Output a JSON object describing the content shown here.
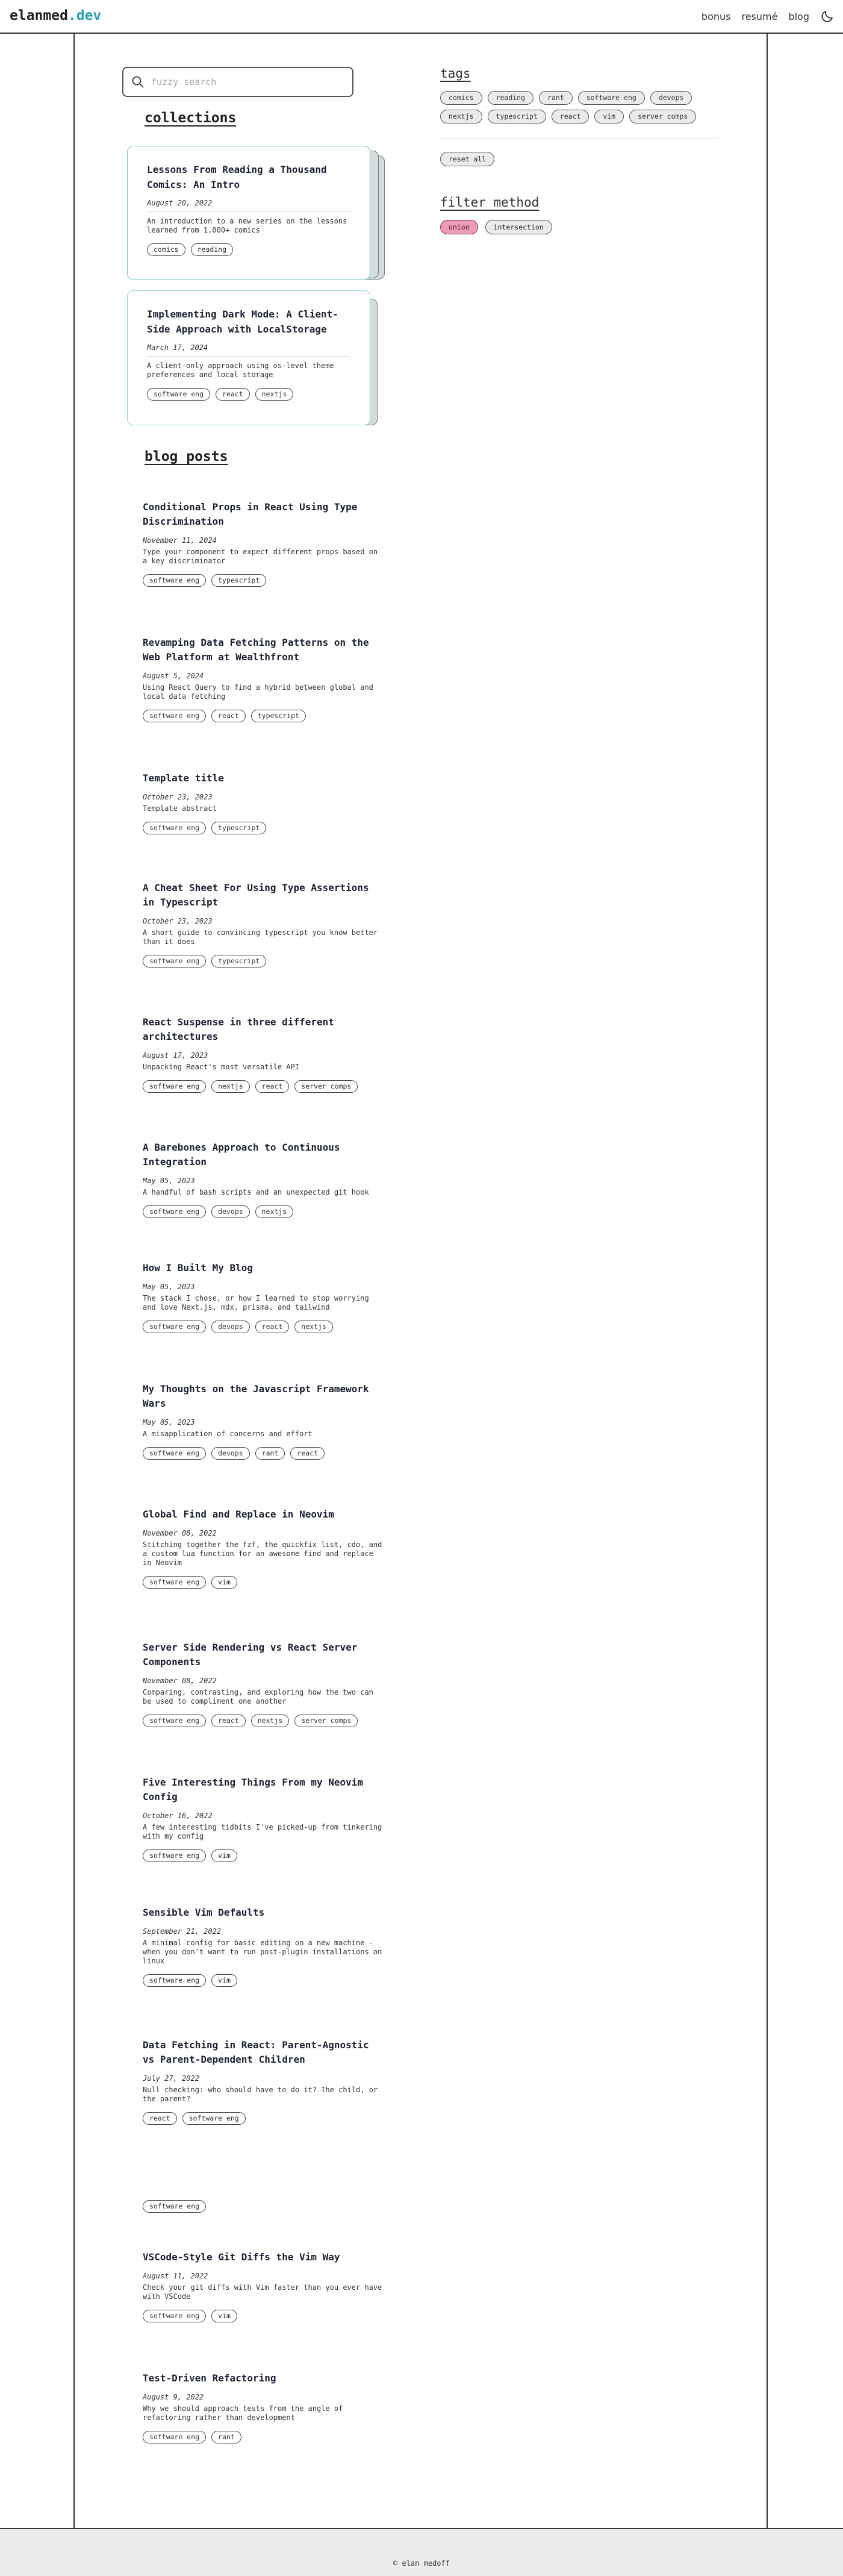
{
  "header": {
    "brand_main": "elanmed",
    "brand_ext": ".dev",
    "nav": [
      "bonus",
      "resumé",
      "blog"
    ]
  },
  "search": {
    "placeholder": "fuzzy search"
  },
  "collections_title": "collections",
  "collections": [
    {
      "title": "Lessons From Reading a Thousand Comics: An Intro",
      "date": "August 20, 2022",
      "description": "An introduction to a new series on the lessons learned from 1,000+ comics",
      "tags": [
        "comics",
        "reading"
      ]
    },
    {
      "title": "Implementing Dark Mode: A Client-Side Approach with LocalStorage",
      "date": "March 17, 2024",
      "description": "A client-only approach using os-level theme preferences and local storage",
      "tags": [
        "software eng",
        "react",
        "nextjs"
      ]
    }
  ],
  "blog_title": "blog posts",
  "posts": [
    {
      "title": "Conditional Props in React Using Type Discrimination",
      "date": "November 11, 2024",
      "description": "Type your component to expect different props based on a key discriminator",
      "tags": [
        "software eng",
        "typescript"
      ]
    },
    {
      "title": "Revamping Data Fetching Patterns on the Web Platform at Wealthfront",
      "date": "August 5, 2024",
      "description": "Using React Query to find a hybrid between global and local data fetching",
      "tags": [
        "software eng",
        "react",
        "typescript"
      ]
    },
    {
      "title": "Template title",
      "date": "October 23, 2023",
      "description": "Template abstract",
      "tags": [
        "software eng",
        "typescript"
      ]
    },
    {
      "title": "A Cheat Sheet For Using Type Assertions in Typescript",
      "date": "October 23, 2023",
      "description": "A short guide to convincing typescript you know better than it does",
      "tags": [
        "software eng",
        "typescript"
      ]
    },
    {
      "title": "React Suspense in three different architectures",
      "date": "August 17, 2023",
      "description": "Unpacking React's most versatile API",
      "tags": [
        "software eng",
        "nextjs",
        "react",
        "server comps"
      ]
    },
    {
      "title": "A Barebones Approach to Continuous Integration",
      "date": "May 05, 2023",
      "description": "A handful of bash scripts and an unexpected git hook",
      "tags": [
        "software eng",
        "devops",
        "nextjs"
      ]
    },
    {
      "title": "How I Built My Blog",
      "date": "May 05, 2023",
      "description": "The stack I chose, or how I learned to stop worrying and love Next.js, mdx, prisma, and tailwind",
      "tags": [
        "software eng",
        "devops",
        "react",
        "nextjs"
      ]
    },
    {
      "title": "My Thoughts on the Javascript Framework Wars",
      "date": "May 05, 2023",
      "description": "A misapplication of concerns and effort",
      "tags": [
        "software eng",
        "devops",
        "rant",
        "react"
      ]
    },
    {
      "title": "Global Find and Replace in Neovim",
      "date": "November 08, 2022",
      "description": "Stitching together the fzf, the quickfix list, cdo, and a custom lua function for an awesome find and replace in Neovim",
      "tags": [
        "software eng",
        "vim"
      ]
    },
    {
      "title": "Server Side Rendering vs React Server Components",
      "date": "November 08, 2022",
      "description": "Comparing, contrasting, and exploring how the two can be used to compliment one another",
      "tags": [
        "software eng",
        "react",
        "nextjs",
        "server comps"
      ]
    },
    {
      "title": "Five Interesting Things From my Neovim Config",
      "date": "October 16, 2022",
      "description": "A few interesting tidbits I've picked-up from tinkering with my config",
      "tags": [
        "software eng",
        "vim"
      ]
    },
    {
      "title": "Sensible Vim Defaults",
      "date": "September 21, 2022",
      "description": "A minimal config for basic editing on a new machine - when you don't want to run post-plugin installations on linux",
      "tags": [
        "software eng",
        "vim"
      ]
    },
    {
      "title": "Data Fetching in React: Parent-Agnostic vs Parent-Dependent Children",
      "date": "July 27, 2022",
      "description": "Null checking: who should have to do it? The child, or the parent?",
      "tags": [
        "react",
        "software eng"
      ]
    },
    {
      "title": "",
      "date": "",
      "description": "",
      "tags": [
        "software eng"
      ]
    },
    {
      "title": "VSCode-Style Git Diffs the Vim Way",
      "date": "August 11, 2022",
      "description": "Check your git diffs with Vim faster than you ever have with VSCode",
      "tags": [
        "software eng",
        "vim"
      ]
    },
    {
      "title": "Test-Driven Refactoring",
      "date": "August 9, 2022",
      "description": "Why we should approach tests from the angle of refactoring rather than development",
      "tags": [
        "software eng",
        "rant"
      ]
    }
  ],
  "sidebar": {
    "tags_title": "tags",
    "tags": [
      "comics",
      "reading",
      "rant",
      "software eng",
      "devops",
      "nextjs",
      "typescript",
      "react",
      "vim",
      "server comps"
    ],
    "reset_label": "reset all",
    "filter_title": "filter method",
    "filter_options": [
      "union",
      "intersection"
    ],
    "active_filter": "union"
  },
  "footer": {
    "text": "© elan medoff"
  },
  "colors": {
    "brand_accent": "#2aa1b2",
    "card_border": "#6cc9d3",
    "active_filter": "#ea9cb9"
  }
}
